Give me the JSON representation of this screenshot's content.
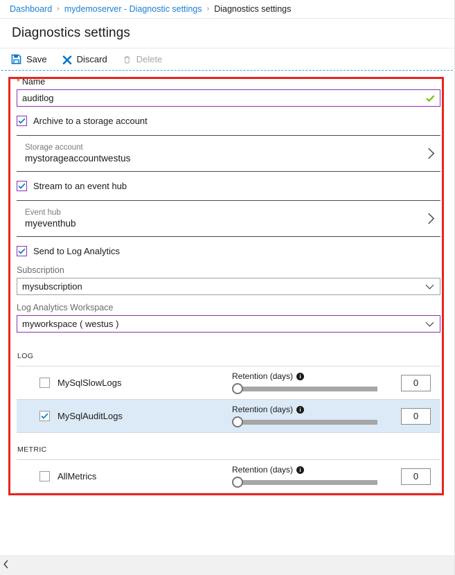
{
  "breadcrumb": {
    "items": [
      {
        "label": "Dashboard",
        "current": false
      },
      {
        "label": "mydemoserver - Diagnostic settings",
        "current": false
      },
      {
        "label": "Diagnostics settings",
        "current": true
      }
    ],
    "separator": "›"
  },
  "header": {
    "title": "Diagnostics settings"
  },
  "toolbar": {
    "save_label": "Save",
    "discard_label": "Discard",
    "delete_label": "Delete"
  },
  "form": {
    "name": {
      "label": "Name",
      "required_marker": "*",
      "value": "auditlog",
      "placeholder": "",
      "validation_state": "valid"
    },
    "archive_storage": {
      "label": "Archive to a storage account",
      "checked": true
    },
    "storage_account": {
      "label": "Storage account",
      "value": "mystorageaccountwestus"
    },
    "stream_event_hub": {
      "label": "Stream to an event hub",
      "checked": true
    },
    "event_hub": {
      "label": "Event hub",
      "value": "myeventhub"
    },
    "send_log_analytics": {
      "label": "Send to Log Analytics",
      "checked": true
    },
    "subscription": {
      "label": "Subscription",
      "value": "mysubscription"
    },
    "workspace": {
      "label": "Log Analytics Workspace",
      "value": "myworkspace ( westus )"
    }
  },
  "log_section": {
    "heading": "LOG",
    "retention_label": "Retention (days)",
    "rows": [
      {
        "name": "MySqlSlowLogs",
        "checked": false,
        "selected": false,
        "retention_value": "0"
      },
      {
        "name": "MySqlAuditLogs",
        "checked": true,
        "selected": true,
        "retention_value": "0"
      }
    ]
  },
  "metric_section": {
    "heading": "METRIC",
    "retention_label": "Retention (days)",
    "rows": [
      {
        "name": "AllMetrics",
        "checked": false,
        "selected": false,
        "retention_value": "0"
      }
    ]
  },
  "colors": {
    "link": "#1a7fd4",
    "accent_focus": "#8b2fb5",
    "valid_check": "#7cbb00",
    "highlight_box": "#e8251c",
    "row_selected": "#dceaf7",
    "required": "#d83b01"
  }
}
